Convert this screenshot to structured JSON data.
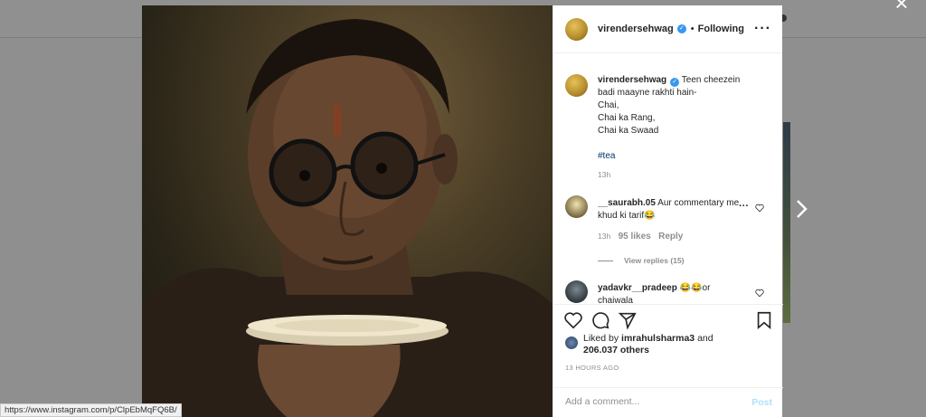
{
  "post": {
    "author": "virendersehwag",
    "follow_status": "Following",
    "caption_lines": [
      "Teen cheezein badi maayne rakhti hain-",
      "Chai,",
      "Chai ka Rang,",
      "Chai ka Swaad"
    ],
    "hashtag": "#tea",
    "caption_time": "13h",
    "likes_user": "imrahulsharma3",
    "likes_rest": "and",
    "likes_count": "206.037 others",
    "timestamp": "13 HOURS AGO"
  },
  "comments": [
    {
      "user": "__saurabh.05",
      "text": "Aur commentary me khud ki tarif😂",
      "time": "13h",
      "likes": "95 likes",
      "reply": "Reply",
      "view_replies": "View replies (15)"
    },
    {
      "user": "yadavkr__pradeep",
      "text": "😂😂or chaiwala"
    }
  ],
  "comment_box": {
    "placeholder": "Add a comment...",
    "post_label": "Post"
  },
  "status_bar": {
    "url": "https://www.instagram.com/p/ClpEbMqFQ6B/"
  },
  "icons": {
    "close": "close-icon",
    "next": "chevron-right-icon",
    "like": "heart-icon",
    "comment": "comment-icon",
    "share": "paper-plane-icon",
    "save": "bookmark-icon",
    "more": "more-options-icon",
    "verified": "verified-badge-icon"
  },
  "colors": {
    "verified": "#3897f0",
    "hashtag": "#00376b",
    "post_disabled": "#b2dffc",
    "overlay": "#8f8f8f"
  }
}
